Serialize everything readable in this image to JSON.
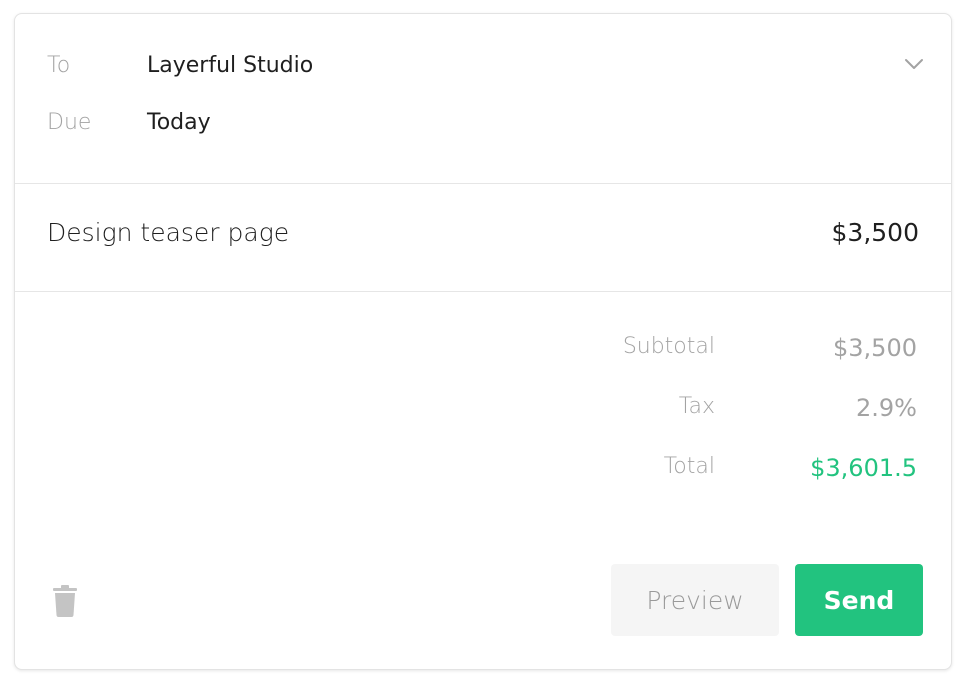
{
  "invoice": {
    "to_label": "To",
    "to_value": "Layerful Studio",
    "due_label": "Due",
    "due_value": "Today"
  },
  "line_item": {
    "description": "Design teaser page",
    "amount": "$3,500"
  },
  "summary": {
    "subtotal_label": "Subtotal",
    "subtotal_value": "$3,500",
    "tax_label": "Tax",
    "tax_value": "2.9%",
    "total_label": "Total",
    "total_value": "$3,601.5"
  },
  "actions": {
    "preview_label": "Preview",
    "send_label": "Send"
  },
  "icons": {
    "recipient_dropdown": "chevron-down-icon",
    "delete": "trash-icon"
  },
  "colors": {
    "accent": "#22c37f",
    "muted_text": "#a3a3a3",
    "primary_text": "#1f1f1f",
    "divider": "#e6e6e6"
  }
}
